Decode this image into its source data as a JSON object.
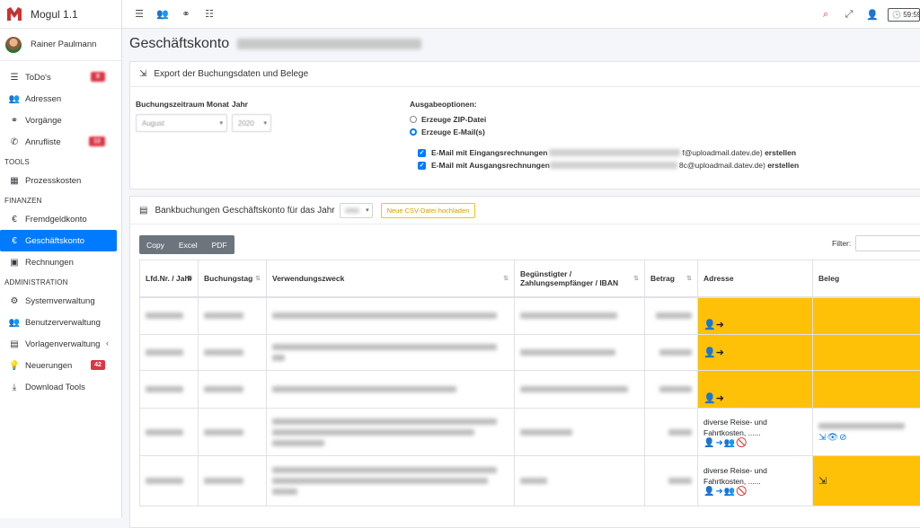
{
  "app": {
    "name": "Mogul 1.1"
  },
  "user": {
    "name": "Rainer Paulmann"
  },
  "nav": {
    "todos": "ToDo's",
    "adressen": "Adressen",
    "vorgaenge": "Vorgänge",
    "anrufliste": "Anrufliste",
    "section_tools": "TOOLS",
    "prozesskosten": "Prozesskosten",
    "section_finanzen": "FINANZEN",
    "fremdgeldkonto": "Fremdgeldkonto",
    "geschaeftskonto": "Geschäftskonto",
    "rechnungen": "Rechnungen",
    "section_admin": "ADMINISTRATION",
    "systemverwaltung": "Systemverwaltung",
    "benutzerverwaltung": "Benutzerverwaltung",
    "vorlagenverwaltung": "Vorlagenverwaltung",
    "neuerungen": "Neuerungen",
    "neuerungen_badge": "42",
    "download_tools": "Download Tools"
  },
  "topbar": {
    "timer": "59:59"
  },
  "page": {
    "title": "Geschäftskonto"
  },
  "export": {
    "header": "Export der Buchungsdaten und Belege",
    "zeitraum_label": "Buchungszeitraum Monat",
    "jahr_label": "Jahr",
    "monat_value": "August",
    "jahr_value": "2020",
    "ausgabe_label": "Ausgabeoptionen:",
    "opt_zip": "Erzeuge ZIP-Datei",
    "opt_mail": "Erzeuge E-Mail(s)",
    "mail_eingang_pre": "E-Mail mit Eingangsrechnungen",
    "mail_eingang_suffix": "f@uploadmail.datev.de)",
    "mail_ausgang_pre": "E-Mail mit Ausgangsrechnungen",
    "mail_ausgang_suffix": "8c@uploadmail.datev.de)",
    "erstellen": "erstellen"
  },
  "bank": {
    "header": "Bankbuchungen Geschäftskonto für das Jahr",
    "upload_label": "Neue CSV-Datei hochladen",
    "btn_copy": "Copy",
    "btn_excel": "Excel",
    "btn_pdf": "PDF",
    "filter_label": "Filter:"
  },
  "table": {
    "columns": [
      "Lfd.Nr. / Jahr",
      "Buchungstag",
      "Verwendungszweck",
      "Begünstigter / Zahlungsempfänger / IBAN",
      "Betrag",
      "Adresse",
      "Beleg"
    ],
    "rows": [
      {
        "adresse": "",
        "beleg": "",
        "adresse_yellow": true,
        "beleg_yellow": true
      },
      {
        "adresse": "",
        "beleg": "",
        "adresse_yellow": true,
        "beleg_yellow": true
      },
      {
        "adresse": "",
        "beleg": "",
        "adresse_yellow": true,
        "beleg_yellow": true
      },
      {
        "adresse": "diverse Reise- und Fahrtkosten, ......",
        "beleg": "",
        "adresse_yellow": false,
        "beleg_yellow": false
      },
      {
        "adresse": "diverse Reise- und Fahrtkosten, ......",
        "beleg": "",
        "adresse_yellow": false,
        "beleg_yellow": true
      }
    ]
  },
  "colors": {
    "accent": "#007bff",
    "warning": "#ffc107",
    "danger": "#dc3545"
  }
}
